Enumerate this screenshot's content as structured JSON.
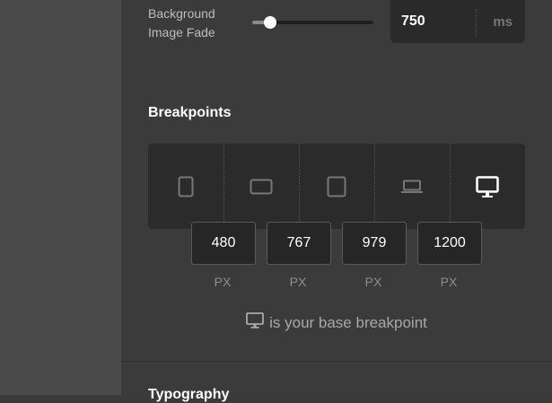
{
  "background_fade": {
    "label": "Background Image Fade",
    "value": "750",
    "unit": "ms",
    "slider_fraction": 0.15
  },
  "breakpoints": {
    "title": "Breakpoints",
    "devices": [
      {
        "icon": "phone-portrait-icon",
        "active": false
      },
      {
        "icon": "phone-landscape-icon",
        "active": false
      },
      {
        "icon": "tablet-icon",
        "active": false
      },
      {
        "icon": "laptop-icon",
        "active": false
      },
      {
        "icon": "desktop-icon",
        "active": true
      }
    ],
    "values": [
      "480",
      "767",
      "979",
      "1200"
    ],
    "unit": "PX",
    "base_note": "is your base breakpoint"
  },
  "next_section": {
    "title": "Typography"
  },
  "colors": {
    "panel": "#3b3b3b",
    "dark_box": "#2b2b2b",
    "active_icon": "#ffffff",
    "inactive_icon": "#777777"
  }
}
